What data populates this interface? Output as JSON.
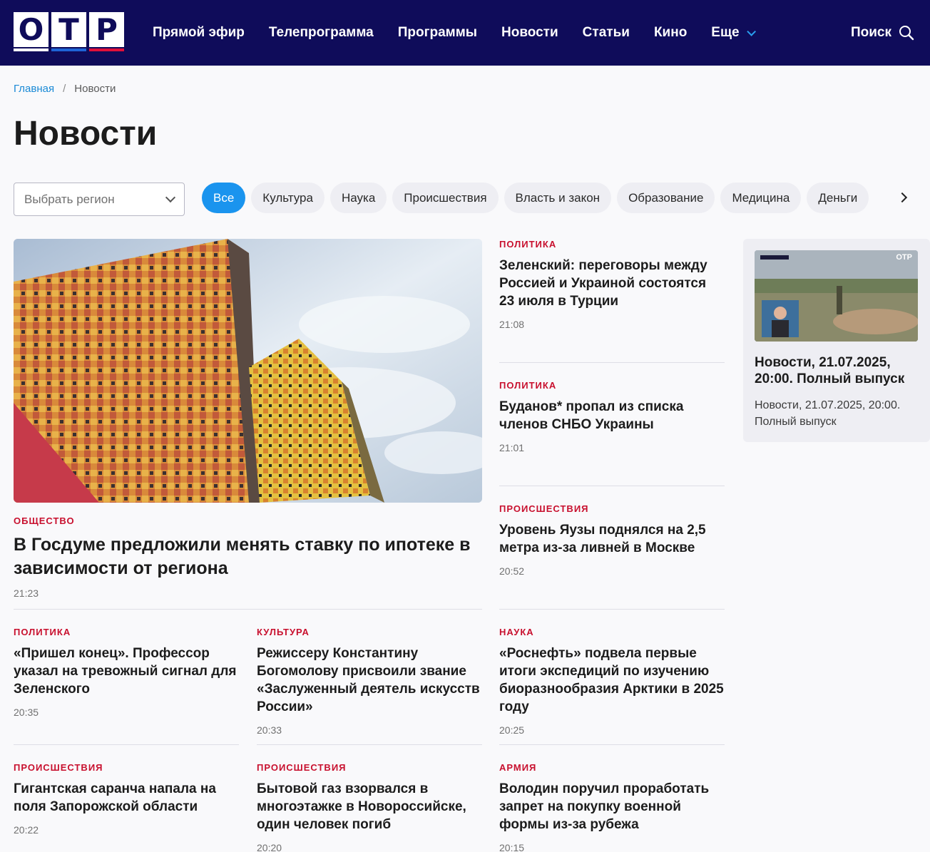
{
  "header": {
    "logo_letters": [
      "О",
      "Т",
      "Р"
    ],
    "logo_bar_colors": [
      "#ffffff",
      "#1e64d6",
      "#e0103a"
    ],
    "nav": [
      {
        "label": "Прямой эфир"
      },
      {
        "label": "Телепрограмма"
      },
      {
        "label": "Программы"
      },
      {
        "label": "Новости"
      },
      {
        "label": "Статьи"
      },
      {
        "label": "Кино"
      },
      {
        "label": "Еще"
      }
    ],
    "search_label": "Поиск",
    "bg_color": "#0f0c5a"
  },
  "breadcrumb": {
    "home": "Главная",
    "separator": "/",
    "current": "Новости"
  },
  "page_title": "Новости",
  "filters": {
    "region_placeholder": "Выбрать регион",
    "chips": [
      "Все",
      "Культура",
      "Наука",
      "Происшествия",
      "Власть и закон",
      "Образование",
      "Медицина",
      "Деньги"
    ],
    "active_chip": "Все",
    "accent": "#1a94ee"
  },
  "feature": {
    "category": "Общество",
    "title": "В Госдуме предложили менять ставку по ипотеке в зависимости от региона",
    "time": "21:23"
  },
  "right_column": [
    {
      "category": "Политика",
      "title": "Зеленский: переговоры между Россией и Украиной состоятся 23 июля в Турции",
      "time": "21:08"
    },
    {
      "category": "Политика",
      "title": "Буданов* пропал из списка членов СНБО Украины",
      "time": "21:01"
    },
    {
      "category": "Происшествия",
      "title": "Уровень Яузы поднялся на 2,5 метра из-за ливней в Москве",
      "time": "20:52"
    }
  ],
  "grid_row1": [
    {
      "category": "Политика",
      "title": "«Пришел конец». Профессор указал на тревожный сигнал для Зеленского",
      "time": "20:35"
    },
    {
      "category": "Культура",
      "title": "Режиссеру Константину Богомолову присвоили звание «Заслуженный деятель искусств России»",
      "time": "20:33"
    },
    {
      "category": "Наука",
      "title": "«Роснефть» подвела первые итоги экспедиций по изучению биоразнообразия Арктики в 2025 году",
      "time": "20:25"
    }
  ],
  "grid_row2": [
    {
      "category": "Происшествия",
      "title": "Гигантская саранча напала на поля Запорожской области",
      "time": "20:22"
    },
    {
      "category": "Происшествия",
      "title": "Бытовой газ взорвался в многоэтажке в Новороссийске, один человек погиб",
      "time": "20:20"
    },
    {
      "category": "Армия",
      "title": "Володин поручил проработать запрет на покупку военной формы из-за рубежа",
      "time": "20:15"
    }
  ],
  "side_card": {
    "title": "Новости, 21.07.2025, 20:00. Полный выпуск",
    "subtitle": "Новости, 21.07.2025, 20:00. Полный выпуск",
    "thumb_badge": "ОТР"
  },
  "category_color": "#c8102e"
}
